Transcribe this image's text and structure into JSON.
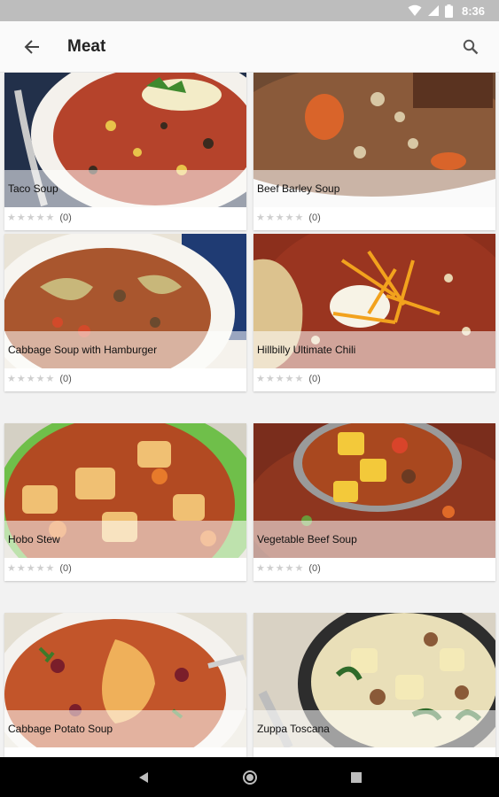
{
  "status_bar": {
    "time": "8:36"
  },
  "app_bar": {
    "title": "Meat"
  },
  "rating_star_glyph": "★",
  "recipes": [
    {
      "title": "Taco Soup",
      "rating_count": "(0)"
    },
    {
      "title": "Beef Barley Soup",
      "rating_count": "(0)"
    },
    {
      "title": "Cabbage Soup with Hamburger",
      "rating_count": "(0)"
    },
    {
      "title": "Hillbilly Ultimate Chili",
      "rating_count": "(0)"
    },
    {
      "title": "Hobo Stew",
      "rating_count": "(0)"
    },
    {
      "title": "Vegetable Beef Soup",
      "rating_count": "(0)"
    },
    {
      "title": "Cabbage Potato Soup",
      "rating_count": ""
    },
    {
      "title": "Zuppa Toscana",
      "rating_count": ""
    }
  ],
  "colors": {
    "status_bar": "#bdbdbd",
    "app_bar": "#fafafa",
    "nav_bar": "#000000",
    "star_empty": "#cfcfcf"
  }
}
